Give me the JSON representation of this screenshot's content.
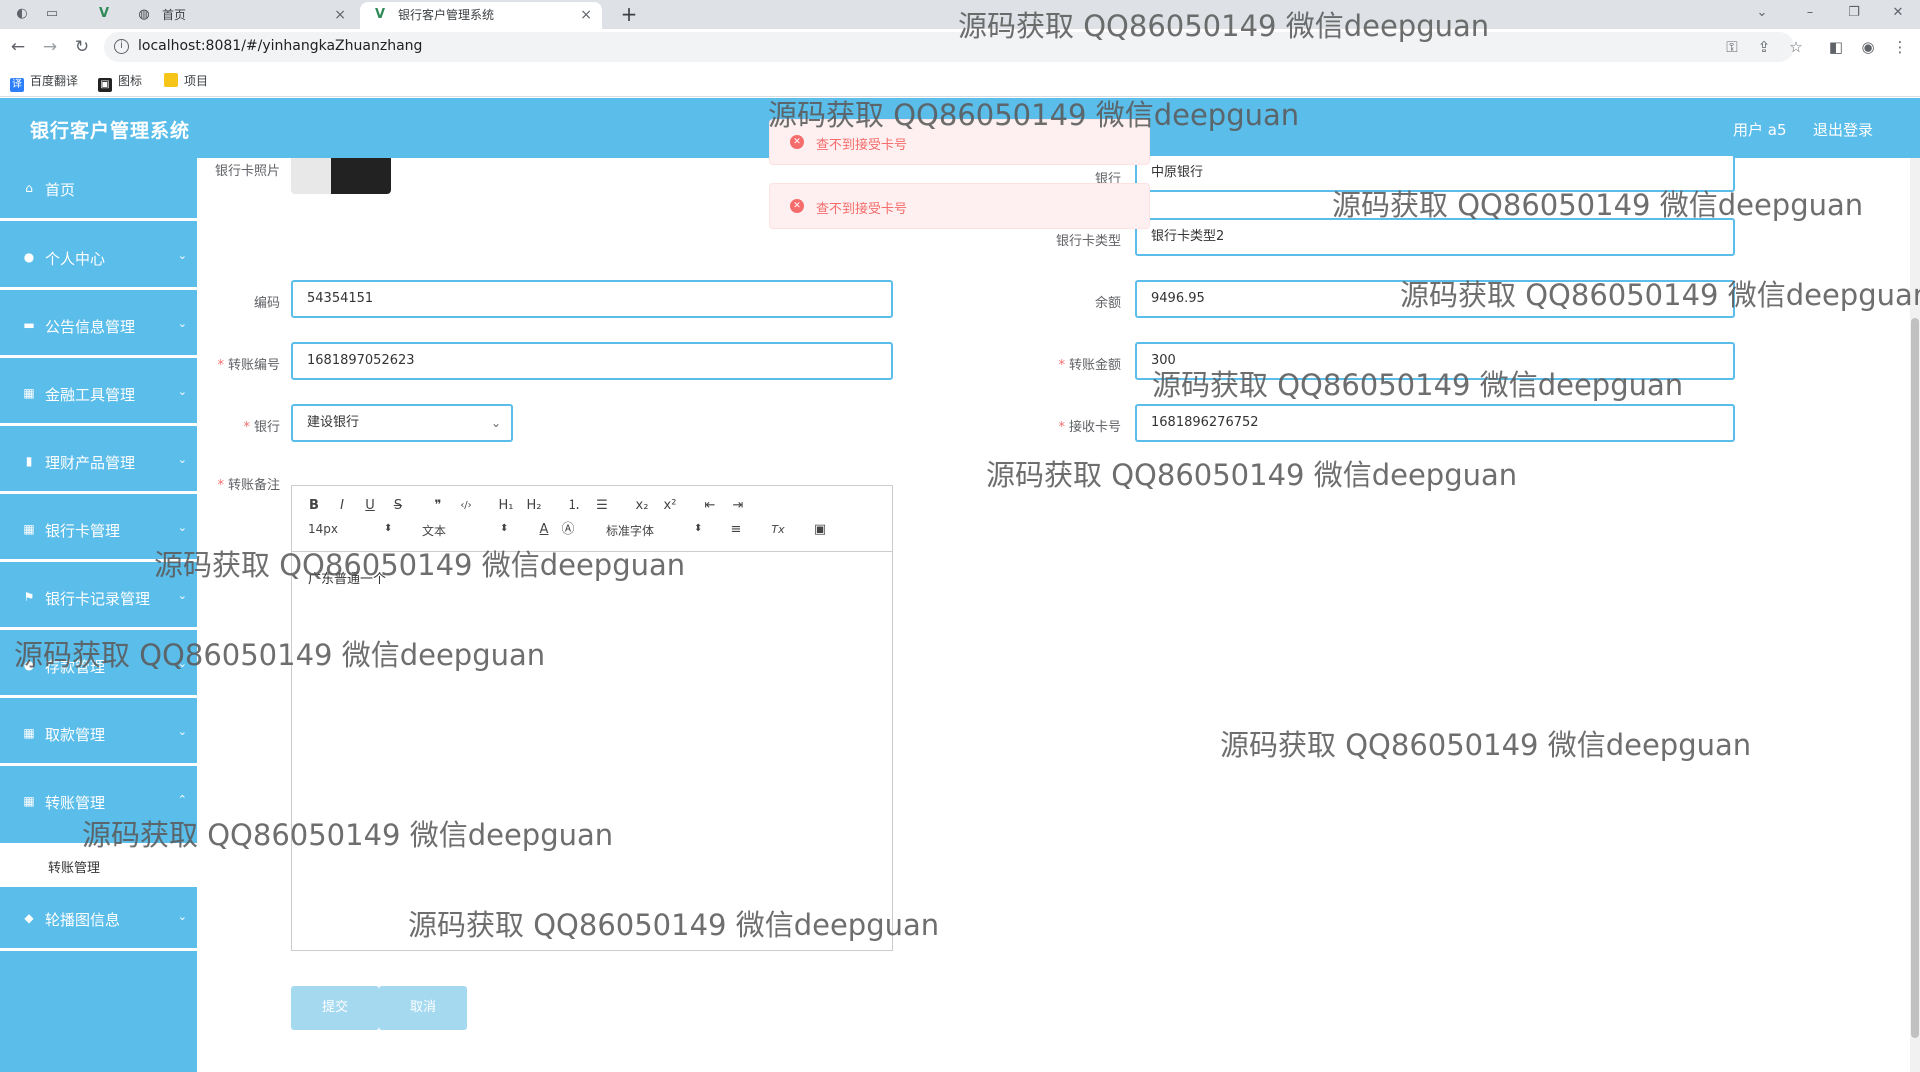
{
  "browser": {
    "tabs": [
      {
        "title": "首页",
        "close": "×"
      },
      {
        "title": "银行客户管理系统",
        "close": "×"
      }
    ],
    "new_tab": "+",
    "url": "localhost:8081/#/yinhangkaZhuanzhang",
    "bookmarks": [
      "百度翻译",
      "图标",
      "项目"
    ]
  },
  "header": {
    "title": "银行客户管理系统",
    "user": "用户 a5",
    "logout": "退出登录"
  },
  "sidebar": {
    "items": [
      {
        "label": "首页",
        "icon": "home-icon",
        "glyph": "⌂",
        "arrow": ""
      },
      {
        "label": "个人中心",
        "icon": "user-icon",
        "glyph": "●",
        "arrow": "⌄"
      },
      {
        "label": "公告信息管理",
        "icon": "notice-icon",
        "glyph": "▬",
        "arrow": "⌄"
      },
      {
        "label": "金融工具管理",
        "icon": "grid-icon",
        "glyph": "▦",
        "arrow": "⌄"
      },
      {
        "label": "理财产品管理",
        "icon": "bar-chart-icon",
        "glyph": "▮",
        "arrow": "⌄"
      },
      {
        "label": "银行卡管理",
        "icon": "grid-icon",
        "glyph": "▦",
        "arrow": "⌄"
      },
      {
        "label": "银行卡记录管理",
        "icon": "flag-icon",
        "glyph": "⚑",
        "arrow": "⌄"
      },
      {
        "label": "存款管理",
        "icon": "user-icon",
        "glyph": "●",
        "arrow": "⌄"
      },
      {
        "label": "取款管理",
        "icon": "grid-icon",
        "glyph": "▦",
        "arrow": "⌄"
      },
      {
        "label": "转账管理",
        "icon": "grid-icon",
        "glyph": "▦",
        "arrow": "⌃"
      },
      {
        "label": "轮播图信息",
        "icon": "thumb-icon",
        "glyph": "◆",
        "arrow": "⌄"
      }
    ],
    "active_sub": "转账管理"
  },
  "form": {
    "photo_label": "银行卡照片",
    "bank_right_label": "银行",
    "bank_right_value": "中原银行",
    "card_type_label": "银行卡类型",
    "card_type_value": "银行卡类型2",
    "code_label": "编码",
    "code_value": "54354151",
    "balance_label": "余额",
    "balance_value": "9496.95",
    "transfer_no_label": "转账编号",
    "transfer_no_value": "1681897052623",
    "amount_label": "转账金额",
    "amount_value": "300",
    "bank_label": "银行",
    "bank_value": "建设银行",
    "receive_card_label": "接收卡号",
    "receive_card_value": "1681896276752",
    "remark_label": "转账备注",
    "required_mark": "*"
  },
  "editor": {
    "buttons": {
      "bold": "B",
      "italic": "I",
      "underline": "U",
      "strike": "S",
      "quote": "❞",
      "code": "‹/›",
      "h1": "H₁",
      "h2": "H₂",
      "ordered_list": "⒈",
      "bullet_list": "☰",
      "sub": "x₂",
      "sup": "x²",
      "outdent": "⇤",
      "indent": "⇥",
      "color": "A",
      "background": "Ⓐ",
      "align": "≡",
      "clean": "Tx",
      "image": "▣"
    },
    "size": "14px",
    "header": "文本",
    "font": "标准字体",
    "content": "广东普通一个"
  },
  "buttons": {
    "submit": "提交",
    "cancel": "取消"
  },
  "toasts": [
    {
      "message": "查不到接受卡号"
    },
    {
      "message": "查不到接受卡号"
    }
  ],
  "watermark": "源码获取 QQ86050149 微信deepguan",
  "colors": {
    "primary": "#5bbde9",
    "button": "#a5d9f0",
    "error": "#f56c6c",
    "error_bg": "#fef0f0"
  }
}
